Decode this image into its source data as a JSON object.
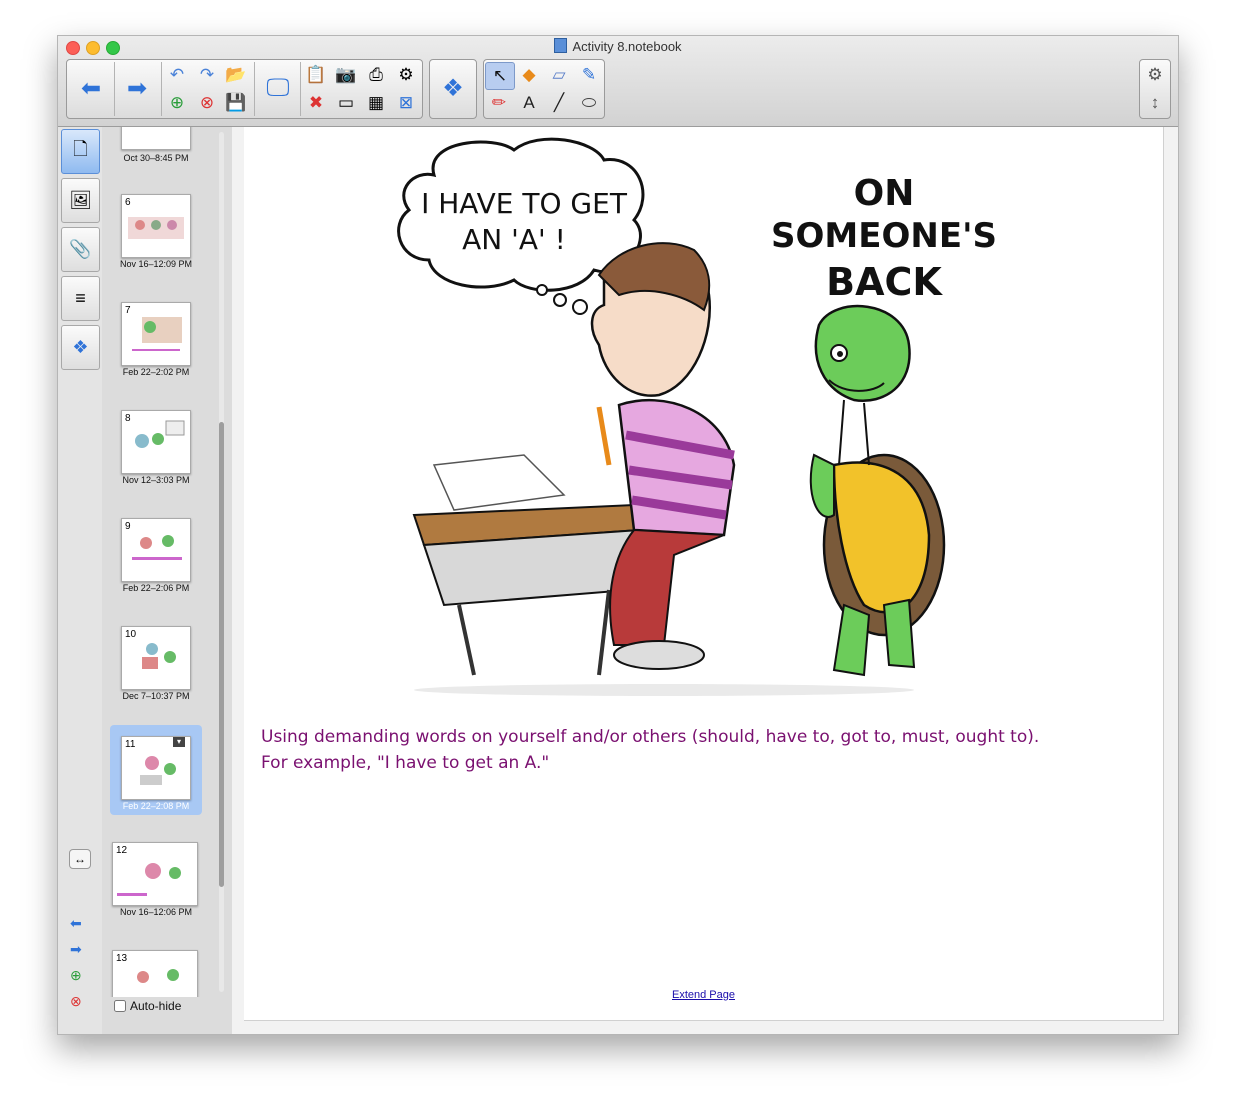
{
  "window": {
    "title": "Activity 8.notebook"
  },
  "toolbar": {
    "back": "back-arrow",
    "forward": "forward-arrow"
  },
  "sorter": {
    "slides": [
      {
        "num": "",
        "date": "Oct 30–8:45 PM"
      },
      {
        "num": "6",
        "date": "Nov 16–12:09 PM"
      },
      {
        "num": "7",
        "date": "Feb 22–2:02 PM"
      },
      {
        "num": "8",
        "date": "Nov 12–3:03 PM"
      },
      {
        "num": "9",
        "date": "Feb 22–2:06 PM"
      },
      {
        "num": "10",
        "date": "Dec 7–10:37 PM"
      },
      {
        "num": "11",
        "date": "Feb 22–2:08 PM",
        "selected": true
      },
      {
        "num": "12",
        "date": "Nov 16–12:06 PM"
      },
      {
        "num": "13",
        "date": ""
      }
    ],
    "autohide_label": "Auto-hide"
  },
  "page": {
    "cartoon": {
      "thought": [
        "I HAVE TO GET",
        "AN 'A' !"
      ],
      "sign": [
        "ON",
        "SOMEONE'S",
        "BACK"
      ]
    },
    "caption_line1": "Using demanding words on yourself and/or others (should, have to, got to, must, ought to).",
    "caption_line2": "For example, \"I have to get an A.\"",
    "extend_link": "Extend Page"
  },
  "colors": {
    "caption": "#7a1070",
    "selection": "#a8c8f4",
    "accent": "#3a7bd5"
  }
}
